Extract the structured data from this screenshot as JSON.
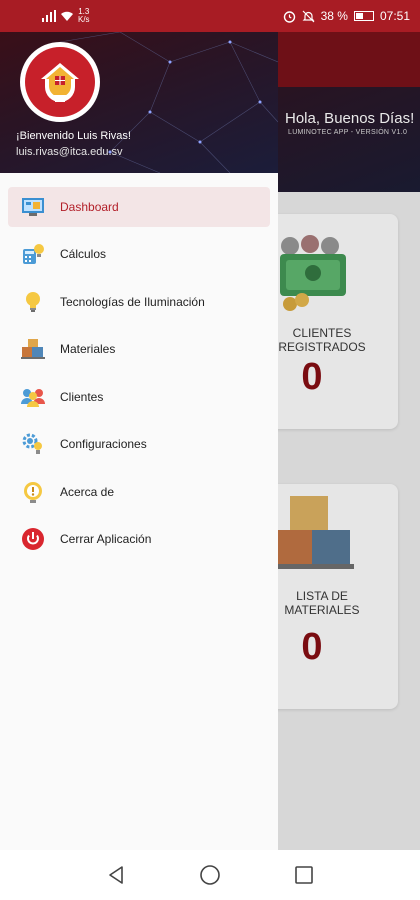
{
  "status_bar": {
    "speed_value": "1.3",
    "speed_unit": "K/s",
    "battery": "38 %",
    "time": "07:51"
  },
  "background_app": {
    "greeting": "Hola, Buenos Días!",
    "version": "LUMINOTEC APP - VERSIÓN V1.0",
    "cards": [
      {
        "label_line1": "CLIENTES",
        "label_line2": "REGISTRADOS",
        "value": "0"
      },
      {
        "label_line1": "LISTA DE",
        "label_line2": "MATERIALES",
        "value": "0"
      }
    ]
  },
  "drawer": {
    "welcome": "¡Bienvenido Luis Rivas!",
    "email": "luis.rivas@itca.edu.sv",
    "items": [
      {
        "label": "Dashboard",
        "icon": "dashboard-icon",
        "active": true
      },
      {
        "label": "Cálculos",
        "icon": "calculations-icon"
      },
      {
        "label": "Tecnologías de Iluminación",
        "icon": "lightbulb-icon"
      },
      {
        "label": "Materiales",
        "icon": "materials-icon"
      },
      {
        "label": "Clientes",
        "icon": "clients-icon"
      },
      {
        "label": "Configuraciones",
        "icon": "settings-icon"
      },
      {
        "label": "Acerca de",
        "icon": "info-icon"
      },
      {
        "label": "Cerrar Aplicación",
        "icon": "power-icon"
      }
    ]
  },
  "colors": {
    "status_bar": "#a81c24",
    "accent": "#b3202a",
    "active_bg": "#f3e5e6",
    "number_red": "#7a0c11"
  }
}
